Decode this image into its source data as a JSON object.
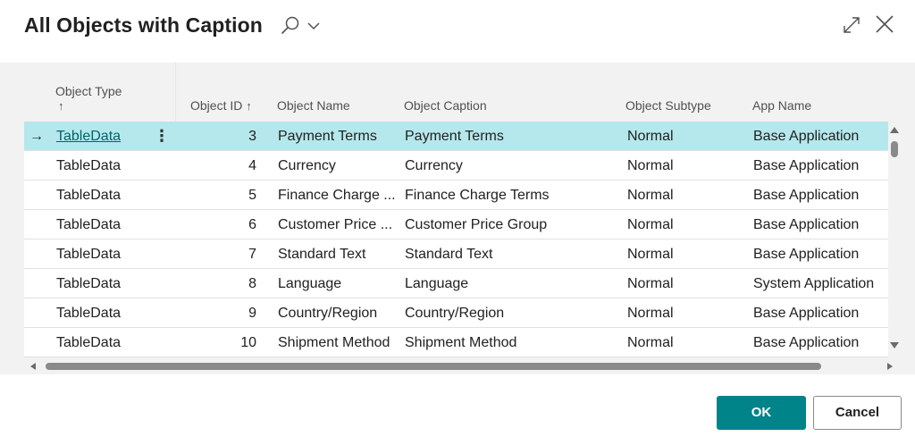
{
  "dialog": {
    "title": "All Objects with Caption",
    "icons": {
      "search": "search-icon",
      "chevron": "chevron-down-icon",
      "expand": "expand-icon",
      "close": "close-icon"
    }
  },
  "columns": {
    "object_type": "Object Type",
    "object_type_sort": "↑",
    "object_id": "Object ID",
    "object_id_sort": "↑",
    "object_name": "Object Name",
    "object_caption": "Object Caption",
    "object_subtype": "Object Subtype",
    "app_name": "App Name"
  },
  "rows": [
    {
      "type": "TableData",
      "id": "3",
      "name": "Payment Terms",
      "caption": "Payment Terms",
      "subtype": "Normal",
      "app": "Base Application"
    },
    {
      "type": "TableData",
      "id": "4",
      "name": "Currency",
      "caption": "Currency",
      "subtype": "Normal",
      "app": "Base Application"
    },
    {
      "type": "TableData",
      "id": "5",
      "name": "Finance Charge ...",
      "caption": "Finance Charge Terms",
      "subtype": "Normal",
      "app": "Base Application"
    },
    {
      "type": "TableData",
      "id": "6",
      "name": "Customer Price ...",
      "caption": "Customer Price Group",
      "subtype": "Normal",
      "app": "Base Application"
    },
    {
      "type": "TableData",
      "id": "7",
      "name": "Standard Text",
      "caption": "Standard Text",
      "subtype": "Normal",
      "app": "Base Application"
    },
    {
      "type": "TableData",
      "id": "8",
      "name": "Language",
      "caption": "Language",
      "subtype": "Normal",
      "app": "System Application"
    },
    {
      "type": "TableData",
      "id": "9",
      "name": "Country/Region",
      "caption": "Country/Region",
      "subtype": "Normal",
      "app": "Base Application"
    },
    {
      "type": "TableData",
      "id": "10",
      "name": "Shipment Method",
      "caption": "Shipment Method",
      "subtype": "Normal",
      "app": "Base Application"
    }
  ],
  "selected_row": {
    "arrow": "→",
    "menu": "⋮"
  },
  "footer": {
    "ok_label": "OK",
    "cancel_label": "Cancel"
  },
  "colors": {
    "accent": "#008489",
    "selected_row": "#b5e8ec",
    "link": "#00656b"
  }
}
